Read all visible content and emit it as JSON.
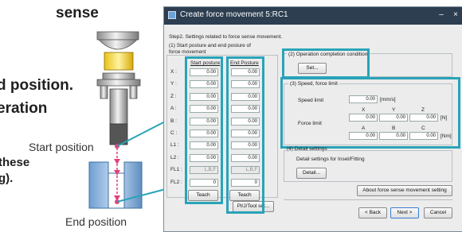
{
  "background": {
    "text_sense": "sense",
    "text_end_position_period": "d position.",
    "text_operation": "eration",
    "text_these": "these",
    "text_g": "g).",
    "start_position": "Start position",
    "end_position": "End position"
  },
  "dialog": {
    "title": "Create force movement 5:RC1",
    "title_icon": "app-icon",
    "step_text": "Step2. Settings related to force sense movement.",
    "section1_label": "(1) Start posture and end posture of force movement",
    "start_col_header": "Start posture",
    "end_col_header": "End Posture",
    "rows": [
      {
        "label": "X :",
        "start": "0.00",
        "end": "0.00"
      },
      {
        "label": "Y :",
        "start": "0.00",
        "end": "0.00"
      },
      {
        "label": "Z :",
        "start": "0.00",
        "end": "0.00"
      },
      {
        "label": "A :",
        "start": "0.00",
        "end": "0.00"
      },
      {
        "label": "B :",
        "start": "0.00",
        "end": "0.00"
      },
      {
        "label": "C :",
        "start": "0.00",
        "end": "0.00"
      },
      {
        "label": "L1 :",
        "start": "0.00",
        "end": "0.00"
      },
      {
        "label": "L2 :",
        "start": "0.00",
        "end": "0.00"
      },
      {
        "label": "FL1 :",
        "start": "L,B,F",
        "end": "L,B,F"
      },
      {
        "label": "FL2 :",
        "start": "0",
        "end": "0"
      }
    ],
    "teach_start": "Teach",
    "teach_end": "Teach",
    "settle_button": "Pl/J/Tool set...",
    "section2_label": "(2) Operation completion condition",
    "set_button": "Set...",
    "section3_label": "(3) Speed, force limit",
    "speed_limit_label": "Speed limit",
    "speed_value": "0.00",
    "speed_unit": "[mm/s]",
    "force_limit_label": "Force limit",
    "xyz_headers": [
      "X",
      "Y",
      "Z"
    ],
    "force_xyz": [
      "0.00",
      "0.00",
      "0.00"
    ],
    "force_unit": "[N]",
    "abc_headers": [
      "A",
      "B",
      "C"
    ],
    "force_abc": [
      "0.00",
      "0.00",
      "0.00"
    ],
    "moment_unit": "[Nm]",
    "section4_label": "(4) Detail settings",
    "detail_text": "Detail settings for Inset/Fitting",
    "detail_button": "Detail...",
    "about_button": "About force sense movement setting",
    "back_button": "< Back",
    "next_button": "Next >",
    "cancel_button": "Cancel",
    "minimize_label": "–",
    "close_label": "×"
  }
}
